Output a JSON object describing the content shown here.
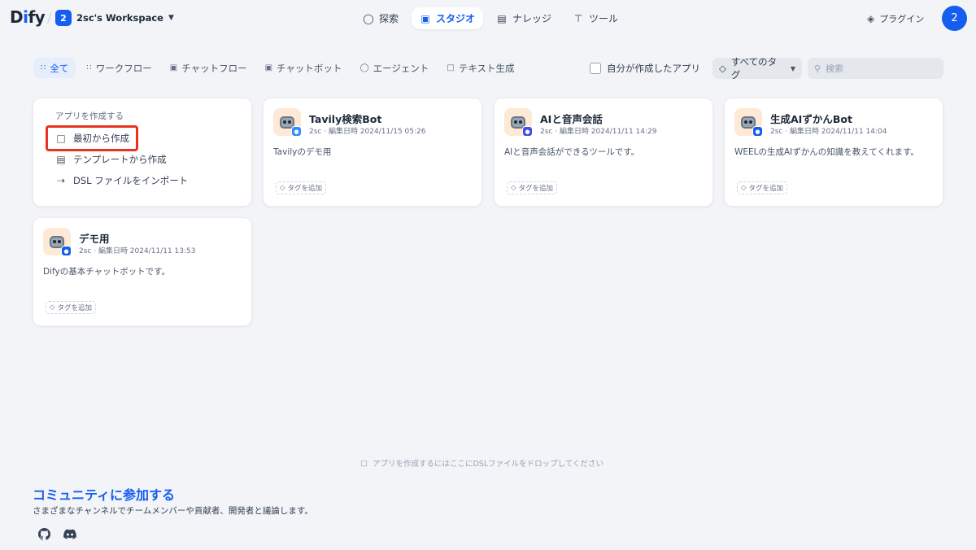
{
  "header": {
    "logo": {
      "d": "D",
      "i": "i",
      "fy": "fy"
    },
    "workspace": {
      "badge": "2",
      "name": "2sc's Workspace"
    },
    "nav": [
      {
        "label": "探索",
        "icon": "compass-icon"
      },
      {
        "label": "スタジオ",
        "icon": "robot-icon"
      },
      {
        "label": "ナレッジ",
        "icon": "book-icon"
      },
      {
        "label": "ツール",
        "icon": "hammer-icon"
      }
    ],
    "plugin_label": "プラグイン",
    "avatar": "2"
  },
  "filters": {
    "tabs": [
      {
        "label": "全て",
        "icon": "grid-icon"
      },
      {
        "label": "ワークフロー",
        "icon": "workflow-icon"
      },
      {
        "label": "チャットフロー",
        "icon": "chatflow-icon"
      },
      {
        "label": "チャットボット",
        "icon": "chatbot-icon"
      },
      {
        "label": "エージェント",
        "icon": "agent-icon"
      },
      {
        "label": "テキスト生成",
        "icon": "text-generation-icon"
      }
    ],
    "mine_label": "自分が作成したアプリ",
    "tag_select": "すべてのタグ",
    "search_placeholder": "検索"
  },
  "create": {
    "title": "アプリを作成する",
    "items": [
      {
        "label": "最初から作成"
      },
      {
        "label": "テンプレートから作成"
      },
      {
        "label": "DSL ファイルをインポート"
      }
    ]
  },
  "apps": [
    {
      "name": "Tavily検索Bot",
      "meta": "2sc · 編集日時 2024/11/15 05:26",
      "desc": "Tavilyのデモ用",
      "tag_add": "タグを追加",
      "badge_color": "#2e90fa"
    },
    {
      "name": "AIと音声会話",
      "meta": "2sc · 編集日時 2024/11/11 14:29",
      "desc": "AIと音声会話ができるツールです。",
      "tag_add": "タグを追加",
      "badge_color": "#444ce7"
    },
    {
      "name": "生成AIずかんBot",
      "meta": "2sc · 編集日時 2024/11/11 14:04",
      "desc": "WEELの生成AIずかんの知識を教えてくれます。",
      "tag_add": "タグを追加",
      "badge_color": "#155eef"
    },
    {
      "name": "デモ用",
      "meta": "2sc · 編集日時 2024/11/11 13:53",
      "desc": "Difyの基本チャットボットです。",
      "tag_add": "タグを追加",
      "badge_color": "#155eef"
    }
  ],
  "drop_hint": "アプリを作成するにはここにDSLファイルをドロップしてください",
  "community": {
    "title": "コミュニティに参加する",
    "desc": "さまざまなチャンネルでチームメンバーや貢献者、開発者と議論します。"
  },
  "colors": {
    "accent": "#155eef",
    "highlight_box": "#e8331f",
    "background": "#f2f4f7"
  }
}
